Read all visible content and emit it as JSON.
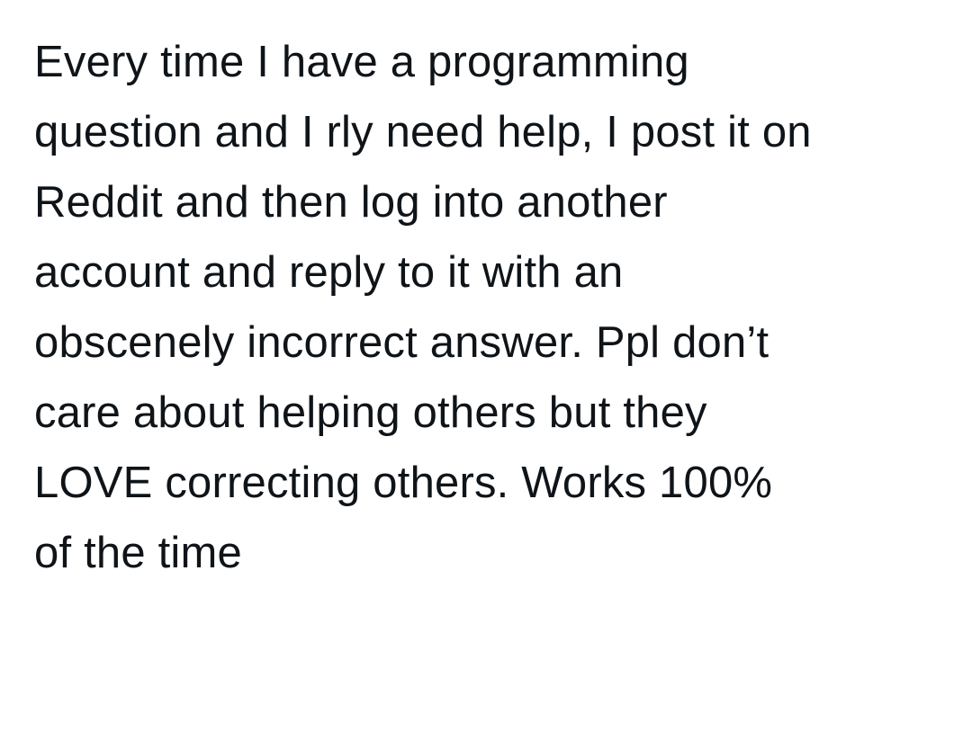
{
  "tweet": {
    "lines": [
      "Every time I have a programming",
      "question and I rly need help, I post it on",
      "Reddit and then log into another",
      "account and reply to it with an",
      "obscenely incorrect answer. Ppl don’t",
      "care about helping others but they",
      "LOVE correcting others. Works 100%",
      "of the time"
    ]
  }
}
